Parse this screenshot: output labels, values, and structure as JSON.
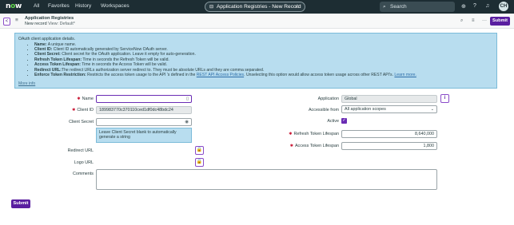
{
  "nav": {
    "logo_prefix": "n",
    "logo_o": "o",
    "logo_suffix": "w",
    "links": [
      "All",
      "Favorites",
      "History",
      "Workspaces"
    ],
    "record_pill": "Application Registries - New Record",
    "record_icon": "⊟",
    "star_icon": "☆",
    "search_placeholder": "Search",
    "search_icon": "⌕",
    "icons": [
      "globe-icon",
      "help-icon",
      "bell-icon"
    ],
    "icon_glyphs": [
      "⊕",
      "?",
      "♫"
    ],
    "avatar_initials": "CH"
  },
  "header": {
    "back_glyph": "<",
    "menu_glyph": "≡",
    "title": "Application Registries",
    "subtitle_record": "New record",
    "subtitle_view": "View: Default*",
    "icon_glyphs": [
      "⌕",
      "≡",
      "···"
    ],
    "submit_label": "Submit"
  },
  "info": {
    "intro": "OAuth client application details.",
    "items": [
      {
        "term": "Name:",
        "desc": " A unique name."
      },
      {
        "term": "Client ID:",
        "desc": " Client ID automatically generated by ServiceNow OAuth server."
      },
      {
        "term": "Client Secret:",
        "desc": " Client secret for the OAuth application. Leave it empty for auto-generation."
      },
      {
        "term": "Refresh Token Lifespan:",
        "desc": " Time in seconds the Refresh Token will be valid."
      },
      {
        "term": "Access Token Lifespan:",
        "desc": " Time in seconds the Access Token will be valid."
      },
      {
        "term": "Redirect URL:",
        "desc": "The redirect URLs authorization server redirect to. They must be absolute URLs and they are comma separated."
      }
    ],
    "last_item_term": "Enforce Token Restriction:",
    "last_item_desc": " Restricts the access token usage to the API 's defined in the ",
    "last_item_link": "REST API Access Policies",
    "last_item_tail": ". Unselecting this option would allow access token usage across other REST API's. ",
    "learn_more": "Learn more.",
    "more_info": "More info"
  },
  "form": {
    "required_mark": "✱",
    "name_label": "Name",
    "name_value": "",
    "name_icon": "▯",
    "client_id_label": "Client ID",
    "client_id_value": "189983770c370110ced1df0dc48bdc24",
    "client_secret_label": "Client Secret",
    "client_secret_value": "",
    "client_secret_icon": "◉",
    "hint_text": "Leave Client Secret blank to automatically generate a string",
    "redirect_url_label": "Redirect URL",
    "logo_url_label": "Logo URL",
    "lock_glyph": "🔒",
    "comments_label": "Comments",
    "application_label": "Application",
    "application_value": "Global",
    "info_glyph": "i",
    "accessible_from_label": "Accessible from",
    "accessible_from_value": "All application scopes",
    "select_caret": "⌄",
    "active_label": "Active",
    "active_checked": true,
    "check_glyph": "✓",
    "refresh_label": "Refresh Token Lifespan",
    "refresh_value": "8,640,000",
    "access_label": "Access Token Lifespan",
    "access_value": "1,800",
    "submit_label": "Submit"
  },
  "colors": {
    "nav_bg": "#1d2d33",
    "brand_green": "#62d84e",
    "accent_purple": "#5a1fa0",
    "info_bg": "#b8ddef",
    "required_red": "#c8102e"
  }
}
